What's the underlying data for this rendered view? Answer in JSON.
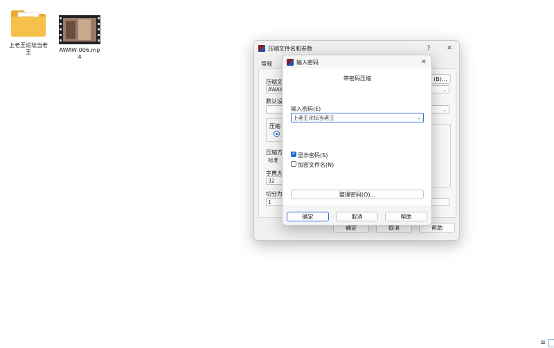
{
  "desktop": {
    "icons": [
      {
        "label": "上老王论坛当老王",
        "icon": "folder-icon"
      },
      {
        "label": "AWAW-006.mp4",
        "icon": "video-file-icon"
      }
    ]
  },
  "back_dialog": {
    "title": "压缩文件名和参数",
    "help_glyph": "?",
    "close_glyph": "✕",
    "tab_general": "常规",
    "label_archive_name": "压缩文",
    "archive_name_value": "AWAW",
    "browse_suffix": "(B)...",
    "label_default": "默认设",
    "label_format": "压缩",
    "label_method": "压缩方",
    "method_value": "标准",
    "label_dict": "字典大",
    "dict_value": "32",
    "label_split": "切分为",
    "split_value": "1",
    "ok": "确定",
    "cancel": "取消",
    "help": "帮助"
  },
  "password_dialog": {
    "title": "输入密码",
    "close_glyph": "✕",
    "header": "带密码压缩",
    "label_enter": "输入密码(E)",
    "password_value": "上老王论坛当老王",
    "show_password_label": "显示密码(S)",
    "show_password_checked": true,
    "encrypt_names_label": "加密文件名(N)",
    "encrypt_names_checked": false,
    "organize_button": "整理密码(O)...",
    "ok": "确定",
    "cancel": "取消",
    "help": "帮助"
  },
  "taskbar": {
    "menu_glyph": "≡"
  },
  "colors": {
    "accent": "#1f6fd1",
    "folder": "#f6c14b",
    "dialog_bg": "#f0f0f0"
  }
}
